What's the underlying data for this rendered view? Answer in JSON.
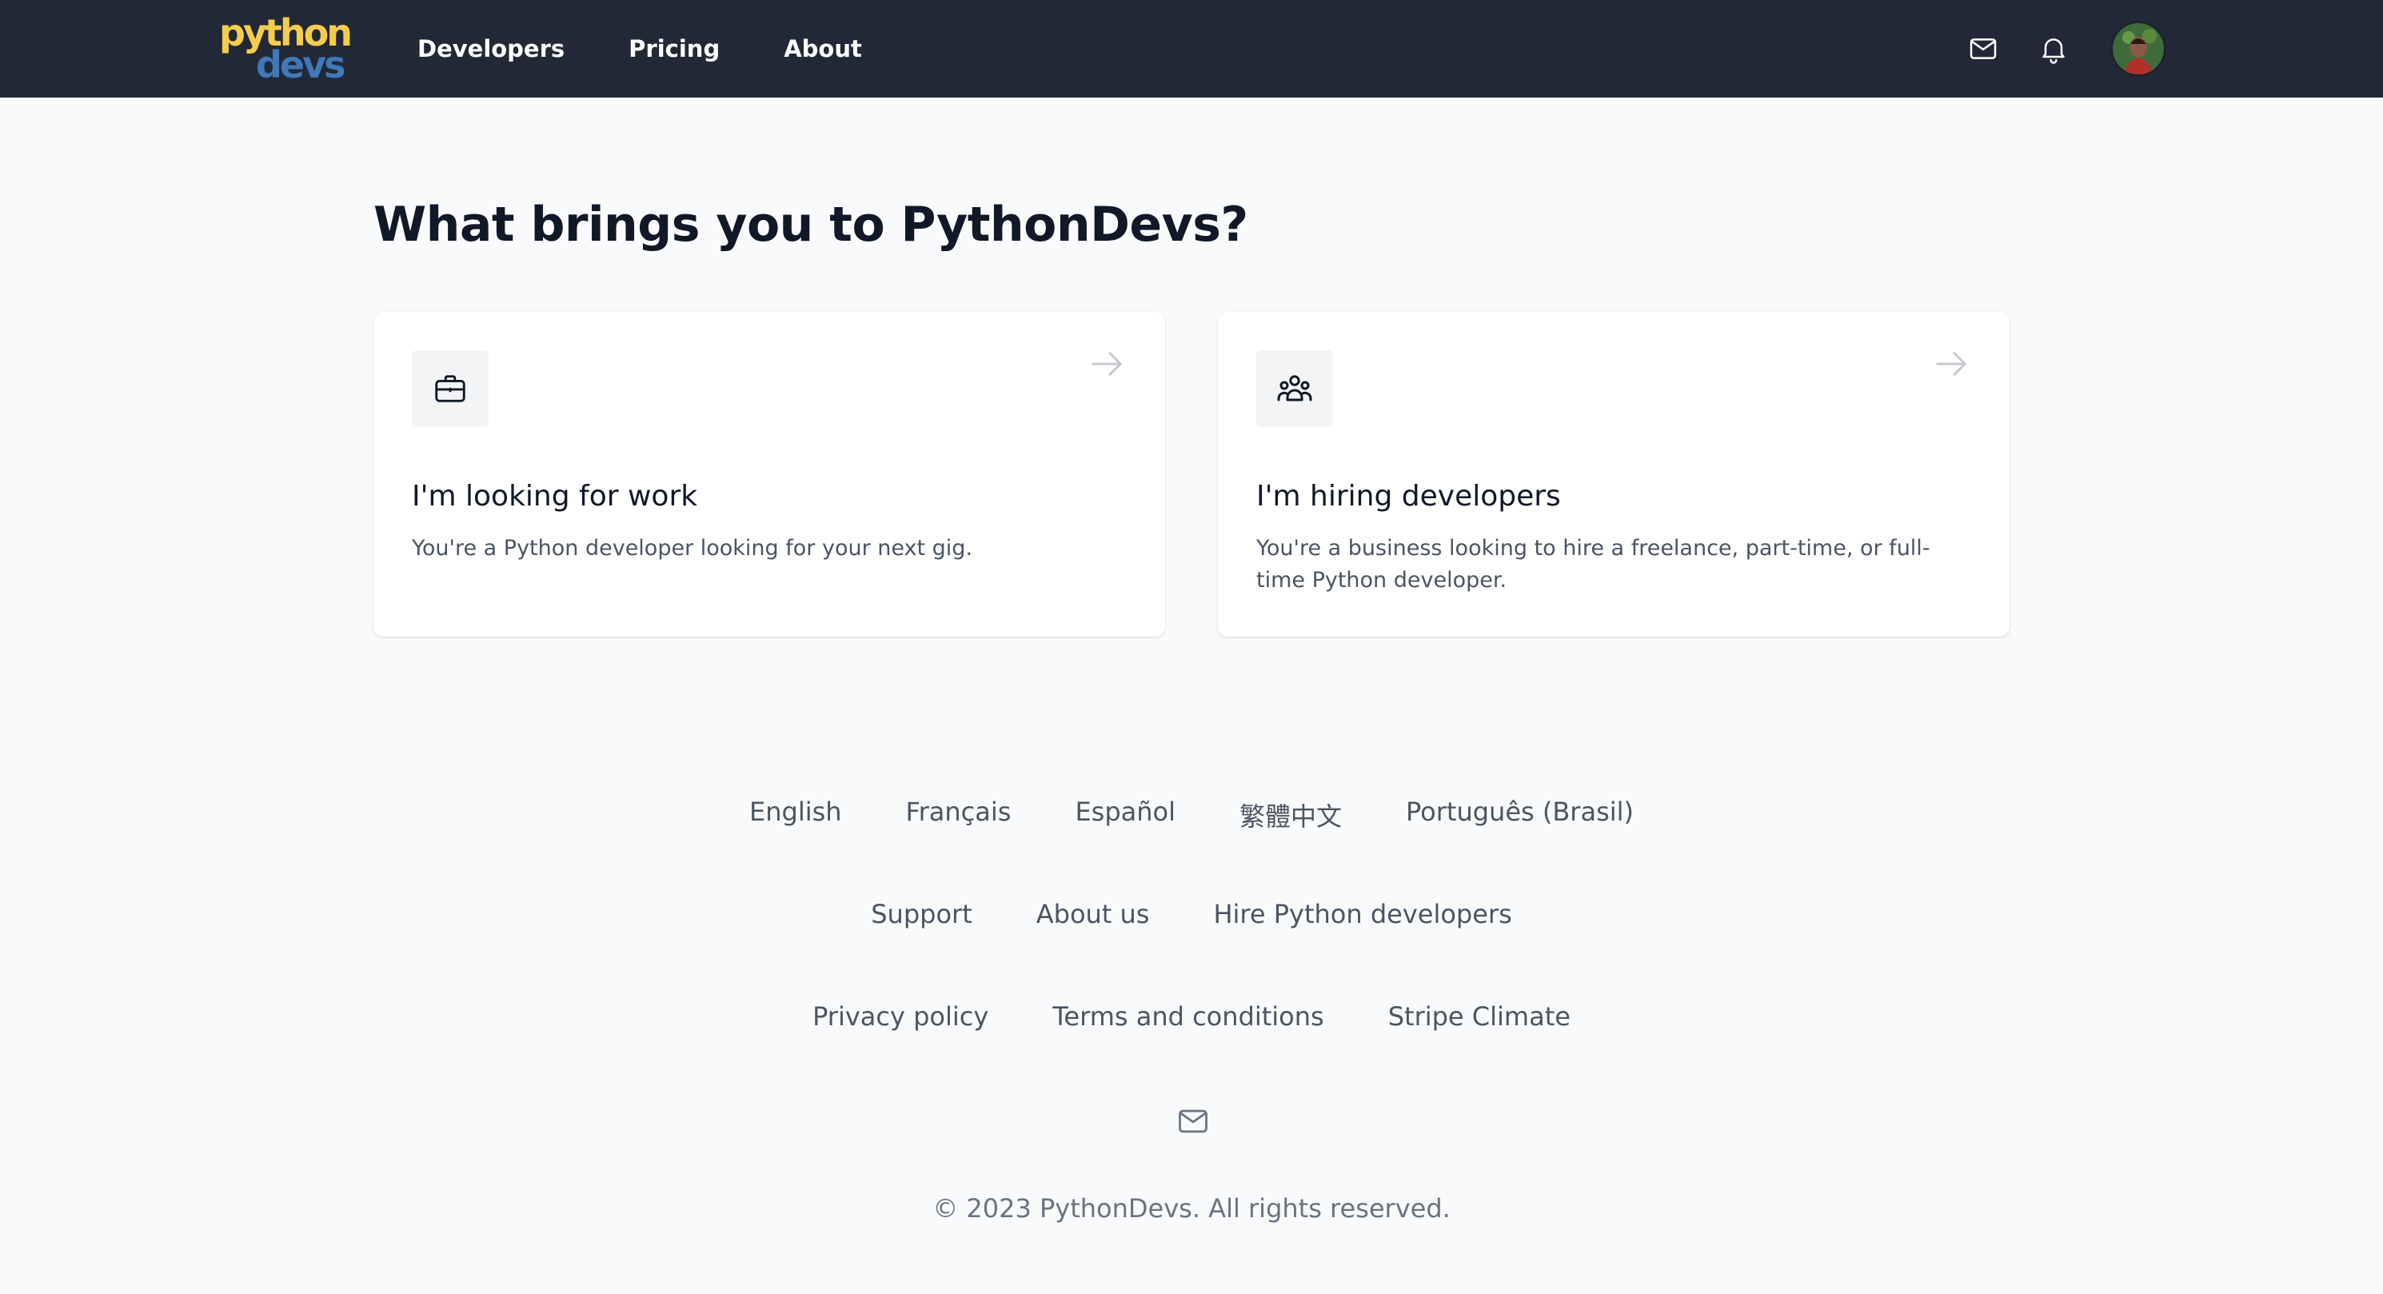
{
  "brand": {
    "logo_line1": "python",
    "logo_line2": "devs"
  },
  "nav": {
    "links": [
      "Developers",
      "Pricing",
      "About"
    ]
  },
  "icons": {
    "mail": "mail-icon",
    "bell": "bell-icon",
    "briefcase": "briefcase-icon",
    "users": "user-group-icon",
    "arrow": "arrow-right-icon"
  },
  "page": {
    "heading": "What brings you to PythonDevs?"
  },
  "cards": [
    {
      "title": "I'm looking for work",
      "description": "You're a Python developer looking for your next gig."
    },
    {
      "title": "I'm hiring developers",
      "description": "You're a business looking to hire a freelance, part-time, or full-time Python developer."
    }
  ],
  "footer": {
    "languages": [
      "English",
      "Français",
      "Español",
      "繁體中文",
      "Português (Brasil)"
    ],
    "links_row2": [
      "Support",
      "About us",
      "Hire Python developers"
    ],
    "links_row3": [
      "Privacy policy",
      "Terms and conditions",
      "Stripe Climate"
    ],
    "copyright": "© 2023 PythonDevs. All rights reserved."
  },
  "colors": {
    "navbar_bg": "#222836",
    "logo_yellow": "#f5cd4c",
    "logo_blue": "#4078b8",
    "page_bg": "#f9fafb",
    "heading": "#111827",
    "muted_text": "#4b5563"
  }
}
